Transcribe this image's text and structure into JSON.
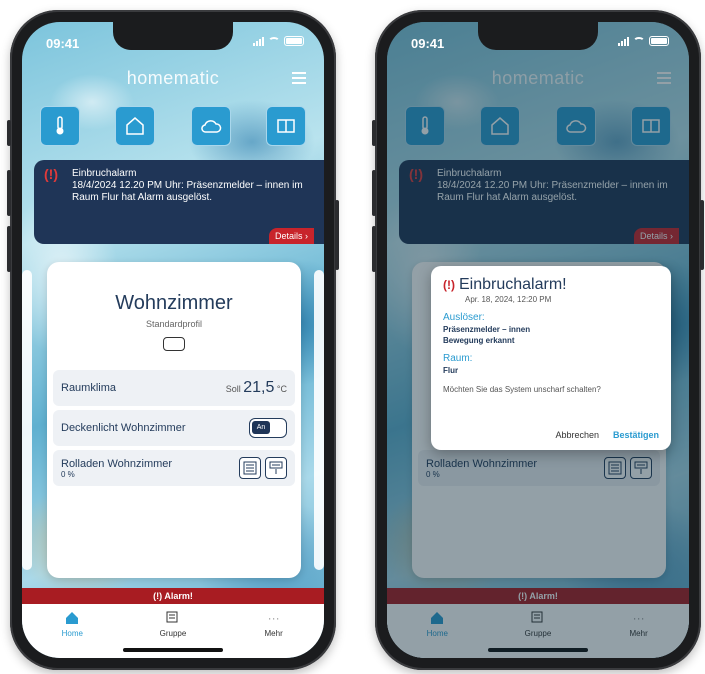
{
  "status": {
    "time": "09:41"
  },
  "brand": "homematic",
  "banner": {
    "title": "Einbruchalarm",
    "text": "18/4/2024 12.20 PM Uhr: Präsenzmelder – innen im Raum Flur hat Alarm ausgelöst.",
    "details": "Details ›"
  },
  "room": {
    "name": "Wohnzimmer",
    "profile": "Standardprofil",
    "climate_label": "Raumklima",
    "climate_soll": "Soll",
    "climate_value": "21,5",
    "climate_unit": "°C",
    "light_label": "Deckenlicht Wohnzimmer",
    "light_toggle": "An",
    "blinds_label": "Rolladen Wohnzimmer",
    "blinds_value": "0 %"
  },
  "alarm_bar": "(!) Alarm!",
  "tabs": [
    {
      "label": "Home"
    },
    {
      "label": "Gruppe"
    },
    {
      "label": "Mehr"
    }
  ],
  "dialog": {
    "title": "Einbruchalarm!",
    "date": "Apr. 18, 2024, 12:20 PM",
    "trigger_label": "Auslöser:",
    "trigger_device": "Präsenzmelder – innen",
    "trigger_event": "Bewegung erkannt",
    "room_label": "Raum:",
    "room_value": "Flur",
    "question": "Möchten Sie das System unscharf schalten?",
    "cancel": "Abbrechen",
    "confirm": "Bestätigen"
  }
}
